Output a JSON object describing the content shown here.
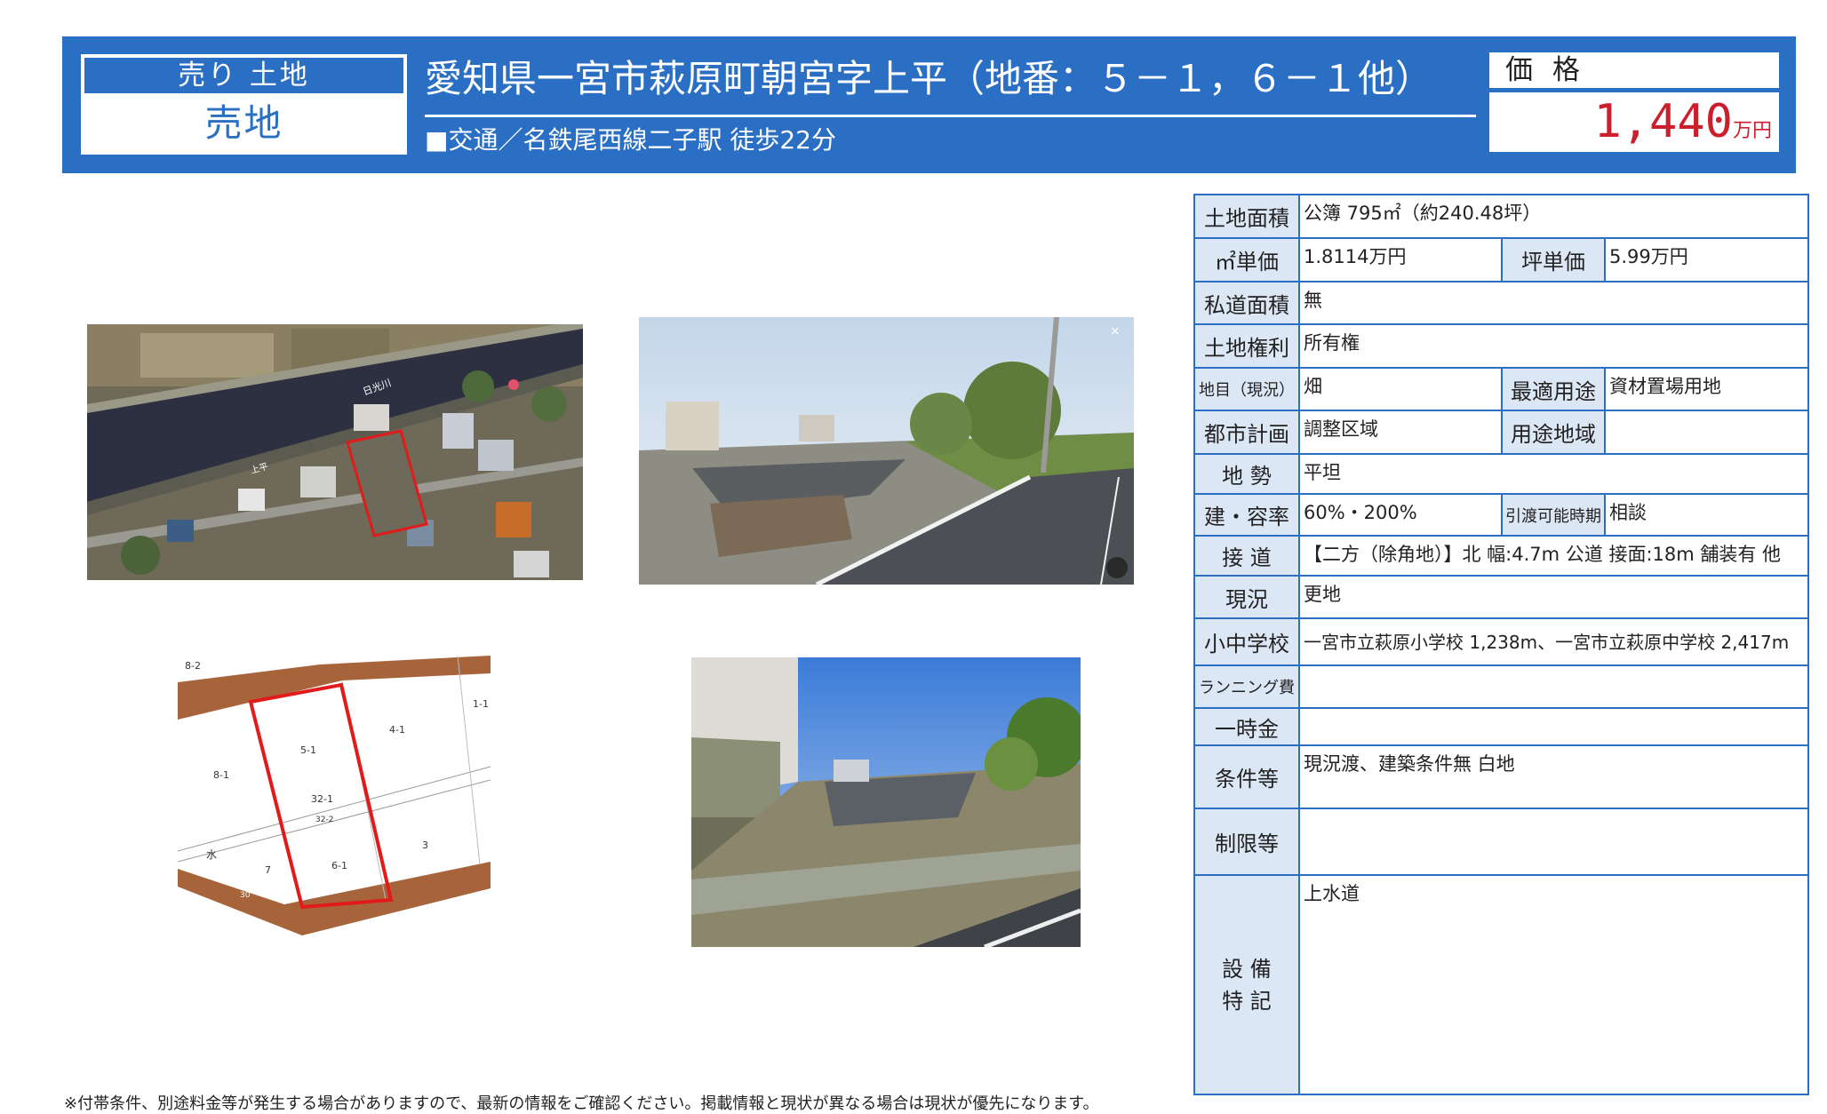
{
  "header": {
    "category_top": "売り 土地",
    "category_main": "売地",
    "address": "愛知県一宮市萩原町朝宮字上平（地番：５－１，６－１他）",
    "traffic": "■交通／名鉄尾西線二子駅 徒歩22分",
    "price_label": "価 格",
    "price_value": "1,440",
    "price_unit": "万円"
  },
  "images": {
    "aerial_river_label": "日光川",
    "aerial_road_label": "上平",
    "plat_labels": {
      "p82": "8-2",
      "p11": "1-1",
      "p51": "5-1",
      "p41": "4-1",
      "p81": "8-1",
      "p321": "32-1",
      "p322": "32-2",
      "p3": "3",
      "p7": "7",
      "p61": "6-1",
      "water": "水",
      "p30": "30"
    }
  },
  "spec": {
    "land_area_label": "土地面積",
    "land_area_value": "公簿 795㎡（約240.48坪）",
    "sqm_price_label": "㎡単価",
    "sqm_price_value": "1.8114万円",
    "tsubo_price_label": "坪単価",
    "tsubo_price_value": "5.99万円",
    "private_road_label": "私道面積",
    "private_road_value": "無",
    "land_right_label": "土地権利",
    "land_right_value": "所有権",
    "land_category_label": "地目（現況）",
    "land_category_value": "畑",
    "best_use_label": "最適用途",
    "best_use_value": "資材置場用地",
    "city_plan_label": "都市計画",
    "city_plan_value": "調整区域",
    "use_zone_label": "用途地域",
    "use_zone_value": "",
    "terrain_label": "地 勢",
    "terrain_value": "平坦",
    "coverage_label": "建・容率",
    "coverage_value": "60%・200%",
    "handover_label": "引渡可能時期",
    "handover_value": "相談",
    "road_label": "接 道",
    "road_value": "【二方（除角地）】北 幅:4.7m 公道 接面:18m 舗装有 他",
    "status_label": "現況",
    "status_value": "更地",
    "school_label": "小中学校",
    "school_value": "一宮市立萩原小学校 1,238m、一宮市立萩原中学校 2,417m",
    "running_label": "ランニング費",
    "running_value": "",
    "lump_label": "一時金",
    "lump_value": "",
    "conditions_label": "条件等",
    "conditions_value": "現況渡、建築条件無 白地",
    "restrictions_label": "制限等",
    "restrictions_value": "",
    "facilities_label": "設 備\n特 記",
    "facilities_value": "上水道"
  },
  "footnote": "※付帯条件、別途料金等が発生する場合がありますので、最新の情報をご確認ください。掲載情報と現状が異なる場合は現状が優先になります。",
  "colors": {
    "brand_blue": "#2a6fc4",
    "price_red": "#cc1f2d",
    "label_bg": "#dce7f5"
  }
}
